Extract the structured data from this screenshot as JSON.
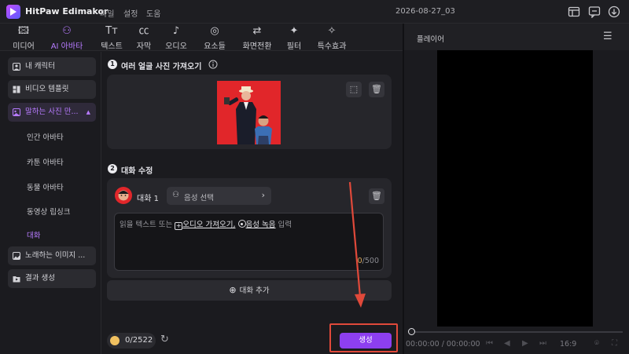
{
  "app": {
    "title": "HitPaw Edimakor",
    "menu": [
      "파일",
      "설정",
      "도움"
    ],
    "project_title": "2026-08-27_03"
  },
  "tabs": [
    {
      "label": "미디어",
      "icon": "media-icon"
    },
    {
      "label": "AI 아바타",
      "icon": "ai-avatar-icon",
      "active": true
    },
    {
      "label": "텍스트",
      "icon": "text-icon"
    },
    {
      "label": "자막",
      "icon": "caption-icon"
    },
    {
      "label": "오디오",
      "icon": "audio-icon"
    },
    {
      "label": "요소들",
      "icon": "elements-icon"
    },
    {
      "label": "화면전환",
      "icon": "transition-icon"
    },
    {
      "label": "필터",
      "icon": "filter-icon"
    },
    {
      "label": "특수효과",
      "icon": "effects-icon"
    }
  ],
  "sidebar": {
    "items": [
      {
        "label": "내 캐릭터"
      },
      {
        "label": "비디오 템플릿"
      },
      {
        "label": "말하는 사진 만...",
        "active": true
      },
      {
        "label": "노래하는 이미지 ..."
      },
      {
        "label": "결과 생성"
      }
    ],
    "subitems": [
      {
        "label": "인간 아바타"
      },
      {
        "label": "카툰 아바타"
      },
      {
        "label": "동물 아바타"
      },
      {
        "label": "동영상 립싱크"
      },
      {
        "label": "대화",
        "active": true
      }
    ]
  },
  "step1": {
    "num": "1",
    "title": "여러 얼굴 사진 가져오기"
  },
  "step2": {
    "num": "2",
    "title": "대화 수정",
    "speaker_label": "대화 1",
    "voice_select": "음성 선택",
    "prompt_prefix": "읽을 텍스트 또는",
    "import_audio": "오디오 가져오기,",
    "record_voice": "음성 녹음",
    "prompt_suffix": "입력",
    "count_current": "0",
    "count_max": "/500",
    "add_conversation": "대화 추가"
  },
  "bottom": {
    "credits": "0/2522",
    "generate": "생성"
  },
  "player": {
    "title": "플레이어",
    "time_current": "00:00:00",
    "time_total": "/ 00:00:00",
    "aspect_ratio": "16:9"
  },
  "colors": {
    "accent": "#8d3ff0",
    "accent_text": "#b77bff",
    "highlight_red": "#e0493a",
    "photo_bg": "#e1262a"
  }
}
